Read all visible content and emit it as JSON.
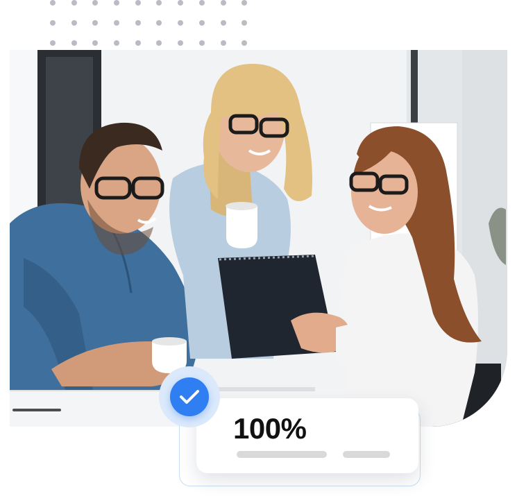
{
  "progress_card": {
    "value_text": "100%"
  },
  "icons": {
    "badge": "checkmark-icon"
  },
  "colors": {
    "accent_blue": "#2f7ef2",
    "accent_blue_light": "#dbe9fb",
    "card_outline": "#c7dcf5",
    "placeholder_bar": "#d9d9d9",
    "dots": "#b9bdc3"
  }
}
